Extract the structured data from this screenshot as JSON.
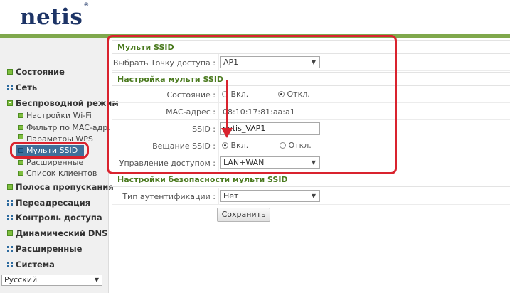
{
  "header": {
    "logo_text": "netis",
    "trademark": "®",
    "accent_color": "#7fa84c",
    "logo_color": "#1d3466"
  },
  "sidebar": {
    "items": [
      {
        "label": "Состояние",
        "icon": "plus-square-icon"
      },
      {
        "label": "Сеть",
        "icon": "grid-icon"
      },
      {
        "label": "Беспроводной режим",
        "icon": "minus-square-icon"
      },
      {
        "label": "Настройки Wi-Fi",
        "icon": "plus-square-icon"
      },
      {
        "label": "Фильтр по MAC-адр.",
        "icon": "plus-square-icon"
      },
      {
        "label": "Параметры WPS",
        "icon": "plus-square-icon"
      },
      {
        "label": "Мульти SSID",
        "icon": "dot-square-icon",
        "active": true
      },
      {
        "label": "Расширенные",
        "icon": "plus-square-icon"
      },
      {
        "label": "Список клиентов",
        "icon": "plus-square-icon"
      },
      {
        "label": "Полоса пропускания",
        "icon": "plus-square-icon"
      },
      {
        "label": "Переадресация",
        "icon": "grid-icon"
      },
      {
        "label": "Контроль доступа",
        "icon": "grid-icon"
      },
      {
        "label": "Динамический DNS",
        "icon": "plus-square-icon"
      },
      {
        "label": "Расширенные",
        "icon": "grid-icon"
      },
      {
        "label": "Система",
        "icon": "grid-icon"
      }
    ],
    "language": "Русский"
  },
  "main": {
    "multi_ssid": {
      "title": "Мульти SSID",
      "ap_label": "Выбрать Точку доступа :",
      "ap_value": "AP1"
    },
    "settings": {
      "title": "Настройка мульти SSID",
      "state_label": "Состояние :",
      "state_on": "Вкл.",
      "state_off": "Откл.",
      "state_selected": "off",
      "mac_label": "MAC-адрес :",
      "mac_value": "08:10:17:81:aa:a1",
      "ssid_label": "SSID :",
      "ssid_value": "netis_VAP1",
      "broadcast_label": "Вещание SSID :",
      "broadcast_on": "Вкл.",
      "broadcast_off": "Откл.",
      "broadcast_selected": "on",
      "access_label": "Управление доступом :",
      "access_value": "LAN+WAN"
    },
    "security": {
      "title": "Настройки безопасности мульти SSID",
      "auth_label": "Тип аутентификации :",
      "auth_value": "Нет"
    },
    "save_label": "Сохранить"
  },
  "annotations": {
    "highlight_color": "#d9232e"
  }
}
